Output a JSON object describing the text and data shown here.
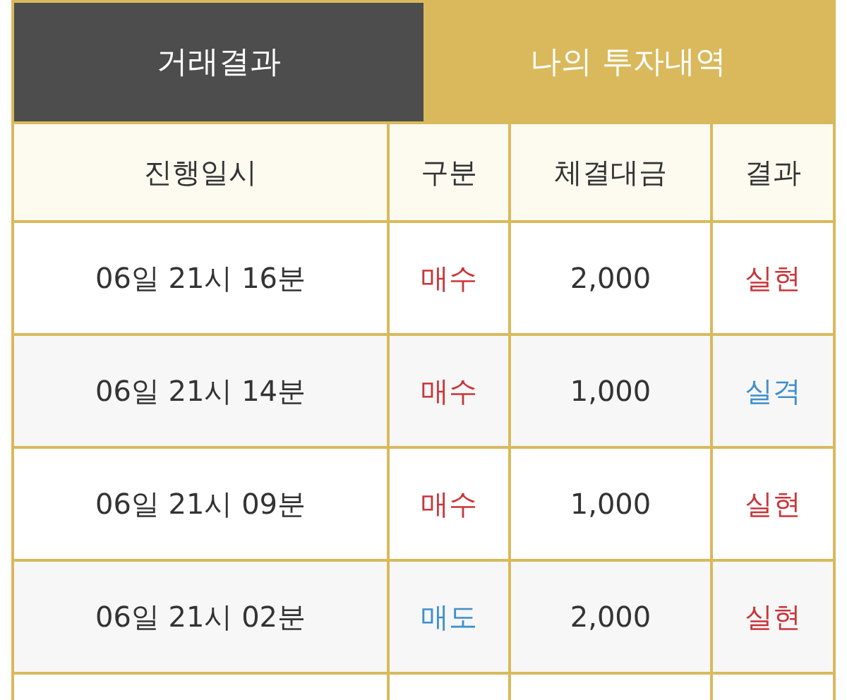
{
  "tabs": [
    {
      "label": "거래결과",
      "selected": true
    },
    {
      "label": "나의 투자내역",
      "selected": false
    }
  ],
  "table": {
    "columns": [
      "진행일시",
      "구분",
      "체결대금",
      "결과"
    ],
    "rows": [
      {
        "time": "06일 21시 16분",
        "side": {
          "text": "매수",
          "color": "#c8363a"
        },
        "amount": "2,000",
        "result": {
          "text": "실현",
          "color": "#c8363a"
        }
      },
      {
        "time": "06일 21시 14분",
        "side": {
          "text": "매수",
          "color": "#c8363a"
        },
        "amount": "1,000",
        "result": {
          "text": "실격",
          "color": "#3f8fcc"
        }
      },
      {
        "time": "06일 21시 09분",
        "side": {
          "text": "매수",
          "color": "#c8363a"
        },
        "amount": "1,000",
        "result": {
          "text": "실현",
          "color": "#c8363a"
        }
      },
      {
        "time": "06일 21시 02분",
        "side": {
          "text": "매도",
          "color": "#3f8fcc"
        },
        "amount": "2,000",
        "result": {
          "text": "실현",
          "color": "#c8363a"
        }
      }
    ]
  }
}
